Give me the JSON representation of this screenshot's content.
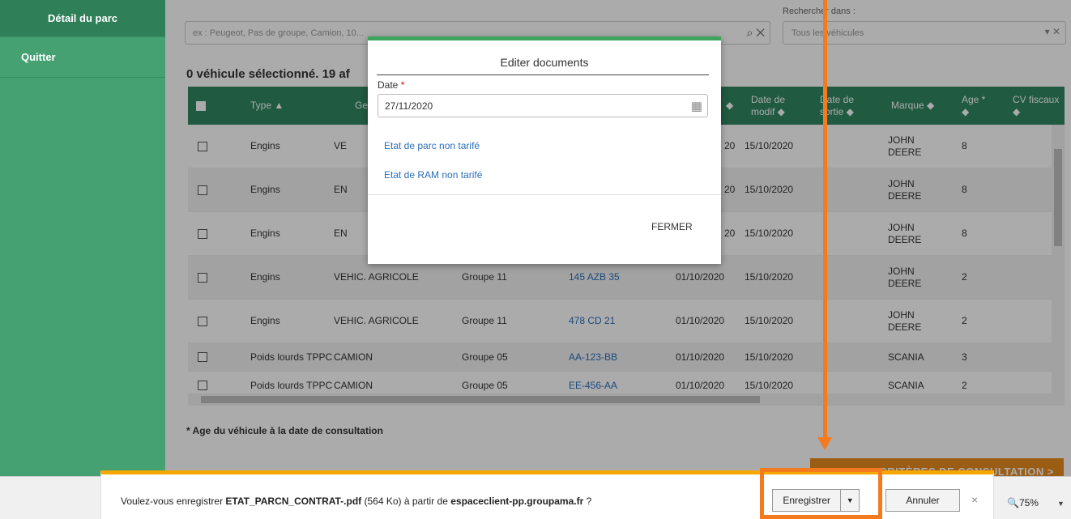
{
  "sidebar": {
    "items": [
      {
        "label": "Détail du parc"
      },
      {
        "label": "Quitter"
      }
    ]
  },
  "search": {
    "placeholder": "ex : Peugeot, Pas de groupe, Camion, 10...",
    "search_icon": "search-icon",
    "clear_icon": "close-icon"
  },
  "search_in": {
    "label": "Rechercher dans :",
    "value": "Tous les véhicules",
    "dropdown_icon": "chevron-down-icon",
    "clear_icon": "close-icon"
  },
  "selection_text": "0 véhicule sélectionné. 19 af",
  "table": {
    "headers": {
      "type": "Type ▲",
      "genre": "Ge",
      "sort_partial": "◆",
      "modif": "Date de modif ◆",
      "sortie": "Date de sortie ◆",
      "marque": "Marque ◆",
      "age": "Age * ◆",
      "cv": "CV fiscaux ◆"
    },
    "rows": [
      {
        "type": "Engins",
        "genre": "VE",
        "groupe": "",
        "immat": "",
        "date_partial": "20",
        "modif": "15/10/2020",
        "sortie": "",
        "marque": "JOHN DEERE",
        "age": "8"
      },
      {
        "type": "Engins",
        "genre": "EN",
        "groupe": "",
        "immat": "",
        "date_partial": "20",
        "modif": "15/10/2020",
        "sortie": "",
        "marque": "JOHN DEERE",
        "age": "8"
      },
      {
        "type": "Engins",
        "genre": "EN",
        "groupe": "",
        "immat": "",
        "date_partial": "20",
        "modif": "15/10/2020",
        "sortie": "",
        "marque": "JOHN DEERE",
        "age": "8"
      },
      {
        "type": "Engins",
        "genre": "VEHIC. AGRICOLE",
        "groupe": "Groupe 11",
        "immat": "145 AZB 35",
        "date_partial": "01/10/2020",
        "modif": "15/10/2020",
        "sortie": "",
        "marque": "JOHN DEERE",
        "age": "2"
      },
      {
        "type": "Engins",
        "genre": "VEHIC. AGRICOLE",
        "groupe": "Groupe 11",
        "immat": "478 CD 21",
        "date_partial": "01/10/2020",
        "modif": "15/10/2020",
        "sortie": "",
        "marque": "JOHN DEERE",
        "age": "2"
      },
      {
        "type": "Poids lourds TPPC",
        "genre": "CAMION",
        "groupe": "Groupe 05",
        "immat": "AA-123-BB",
        "date_partial": "01/10/2020",
        "modif": "15/10/2020",
        "sortie": "",
        "marque": "SCANIA",
        "age": "3"
      },
      {
        "type": "Poids lourds TPPC",
        "genre": "CAMION",
        "groupe": "Groupe 05",
        "immat": "EE-456-AA",
        "date_partial": "01/10/2020",
        "modif": "15/10/2020",
        "sortie": "",
        "marque": "SCANIA",
        "age": "2"
      }
    ]
  },
  "footnote": "* Age du véhicule à la date de consultation",
  "consult_button": "CRITÈRES DE CONSULTATION >",
  "modal": {
    "title": "Editer documents",
    "date_label": "Date",
    "required_mark": "*",
    "date_value": "27/11/2020",
    "calendar_icon": "calendar-icon",
    "links": [
      "Etat de parc non tarifé",
      "Etat de RAM non tarifé"
    ],
    "close_label": "FERMER"
  },
  "download": {
    "prefix": "Voulez-vous enregistrer ",
    "filename": "ETAT_PARCN_CONTRAT-.pdf",
    "size": " (564 Ko) à partir de ",
    "site": "espaceclient-pp.groupama.fr",
    "suffix": " ?",
    "save_label": "Enregistrer",
    "cancel_label": "Annuler",
    "close_glyph": "×"
  },
  "zoom": {
    "value": "75%",
    "icon": "zoom-icon"
  },
  "annotation": {
    "color": "#f37a1f"
  },
  "colors": {
    "sidebar": "#45a072",
    "header": "#308761",
    "accent": "#e8891f",
    "modal_top": "#3da35d",
    "dl_bar": "#f6a800"
  }
}
